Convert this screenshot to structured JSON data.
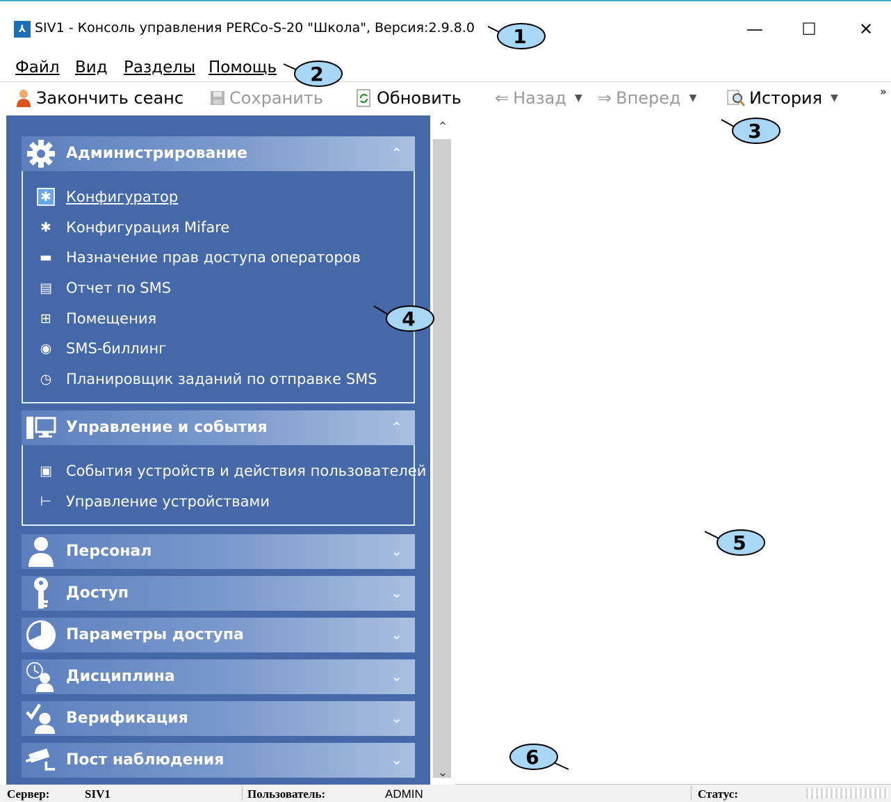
{
  "window": {
    "title": "SIV1 - Консоль управления PERCo-S-20 \"Школа\", Версия:2.9.8.0",
    "minimize": "—",
    "maximize": "☐",
    "close": "✕"
  },
  "menu": {
    "items": [
      {
        "label": "Файл"
      },
      {
        "label": "Вид"
      },
      {
        "label": "Разделы"
      },
      {
        "label": "Помощь"
      }
    ]
  },
  "toolbar": {
    "end_session": "Закончить сеанс",
    "save": "Сохранить",
    "refresh": "Обновить",
    "back": "Назад",
    "forward": "Вперед",
    "history": "История",
    "overflow": "»"
  },
  "nav": {
    "groups": [
      {
        "title": "Администрирование",
        "icon": "gear-icon",
        "chevron": "⌃⌃",
        "expanded": true,
        "items": [
          {
            "label": "Конфигуратор",
            "icon": "gear-icon",
            "active": true
          },
          {
            "label": "Конфигурация Mifare",
            "icon": "gear-icon"
          },
          {
            "label": "Назначение прав доступа операторов",
            "icon": "monitor-key-icon"
          },
          {
            "label": "Отчет по SMS",
            "icon": "document-icon"
          },
          {
            "label": "Помещения",
            "icon": "floorplan-icon"
          },
          {
            "label": "SMS-биллинг",
            "icon": "coins-icon"
          },
          {
            "label": "Планировщик заданий по отправке SMS",
            "icon": "scheduler-icon"
          }
        ]
      },
      {
        "title": "Управление и события",
        "icon": "computer-icon",
        "expanded": true,
        "items": [
          {
            "label": "События устройств и действия пользователей",
            "icon": "events-icon"
          },
          {
            "label": "Управление устройствами",
            "icon": "turnstile-icon"
          }
        ]
      },
      {
        "title": "Персонал",
        "icon": "person-icon",
        "expanded": false
      },
      {
        "title": "Доступ",
        "icon": "key-icon",
        "expanded": false
      },
      {
        "title": "Параметры доступа",
        "icon": "clock-icon",
        "expanded": false
      },
      {
        "title": "Дисциплина",
        "icon": "clock-person-icon",
        "expanded": false
      },
      {
        "title": "Верификация",
        "icon": "check-person-icon",
        "expanded": false
      },
      {
        "title": "Пост наблюдения",
        "icon": "camera-icon",
        "expanded": false
      }
    ]
  },
  "status": {
    "server_label": "Сервер:",
    "server_value": "SIV1",
    "user_label": "Пользователь:",
    "user_value": "ADMIN",
    "status_label": "Статус:"
  },
  "callouts": [
    "1",
    "2",
    "3",
    "4",
    "5",
    "6"
  ]
}
